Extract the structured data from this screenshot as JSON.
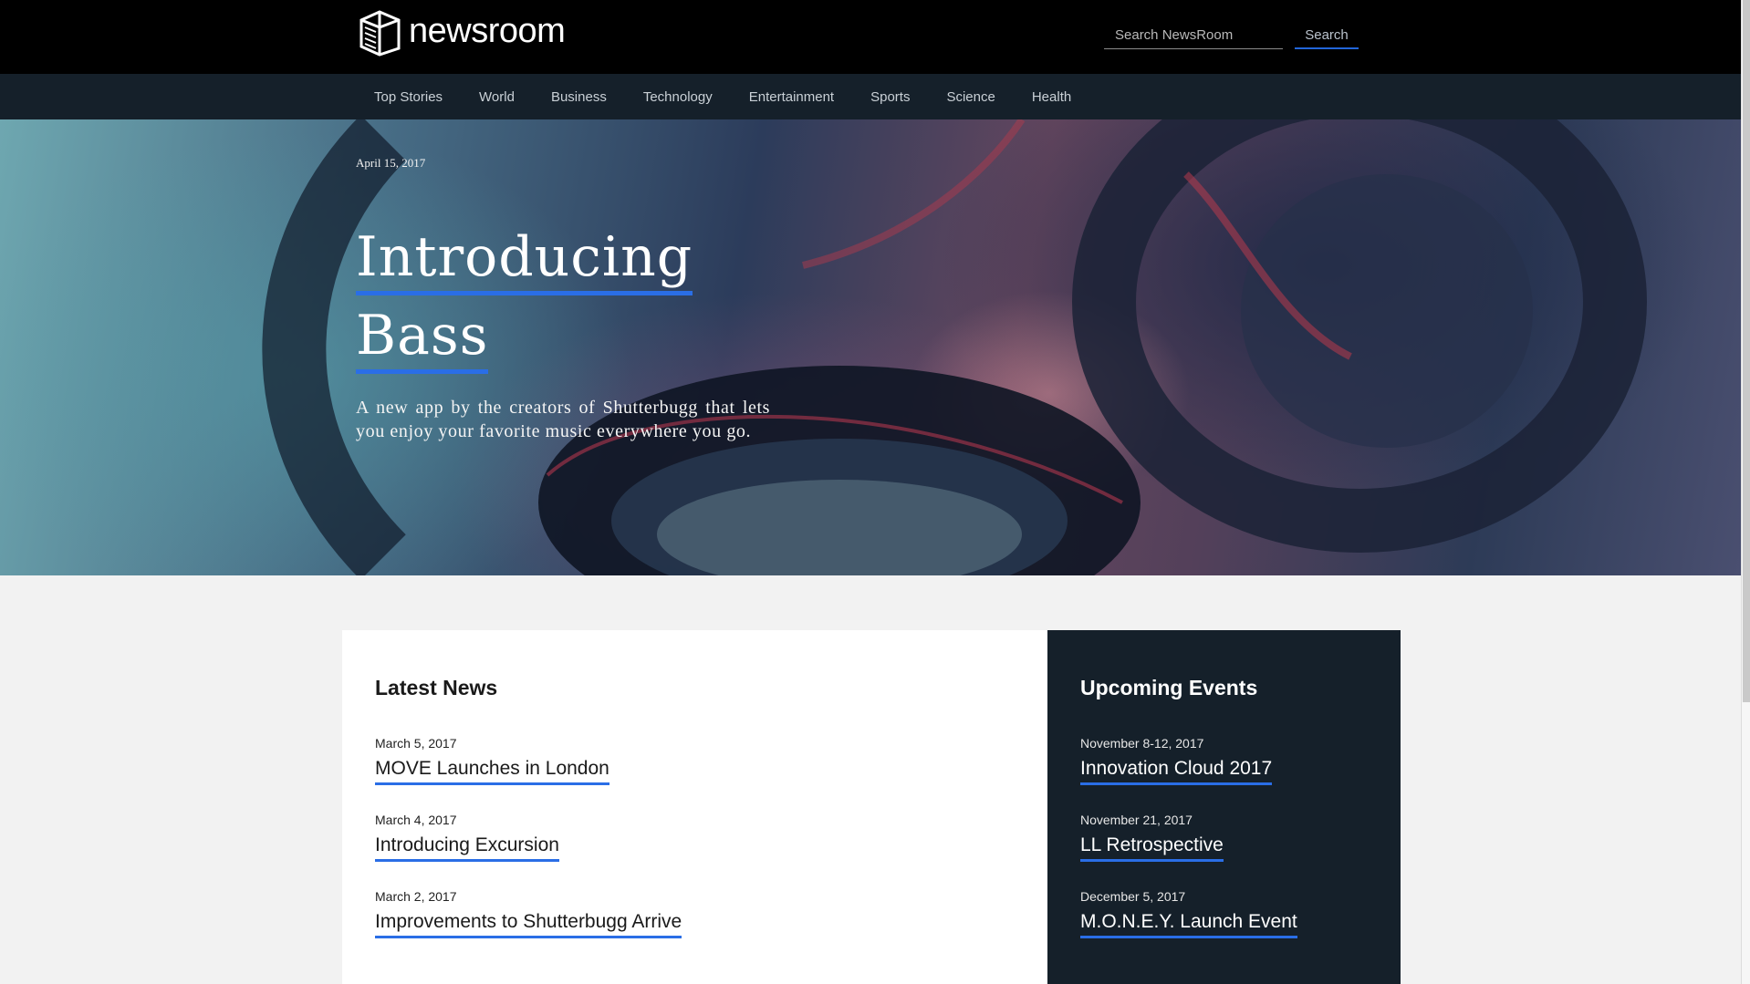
{
  "brand": {
    "name": "newsroom",
    "logo_icon": "cube-building-icon"
  },
  "search": {
    "placeholder": "Search NewsRoom",
    "button_label": "Search"
  },
  "nav": {
    "items": [
      {
        "label": "Top Stories"
      },
      {
        "label": "World"
      },
      {
        "label": "Business"
      },
      {
        "label": "Technology"
      },
      {
        "label": "Entertainment"
      },
      {
        "label": "Sports"
      },
      {
        "label": "Science"
      },
      {
        "label": "Health"
      }
    ]
  },
  "hero": {
    "date": "April 15, 2017",
    "title_line1": "Introducing",
    "title_line2": "Bass",
    "subtitle": "A new app by the creators of Shutterbugg that lets you enjoy your favorite music everywhere you go.",
    "image": "headphones-photo"
  },
  "latest_news": {
    "heading": "Latest News",
    "items": [
      {
        "date": "March 5, 2017",
        "title": "MOVE Launches in London"
      },
      {
        "date": "March 4, 2017",
        "title": "Introducing Excursion"
      },
      {
        "date": "March 2, 2017",
        "title": "Improvements to Shutterbugg Arrive"
      }
    ]
  },
  "upcoming_events": {
    "heading": "Upcoming Events",
    "items": [
      {
        "date": "November 8-12, 2017",
        "title": "Innovation Cloud 2017"
      },
      {
        "date": "November 21, 2017",
        "title": "LL Retrospective"
      },
      {
        "date": "December 5, 2017",
        "title": "M.O.N.E.Y. Launch Event"
      }
    ]
  },
  "colors": {
    "topbar": "#000000",
    "navbar": "#15202a",
    "accent": "#2a6ee6",
    "page_bg": "#f2f2f2"
  }
}
